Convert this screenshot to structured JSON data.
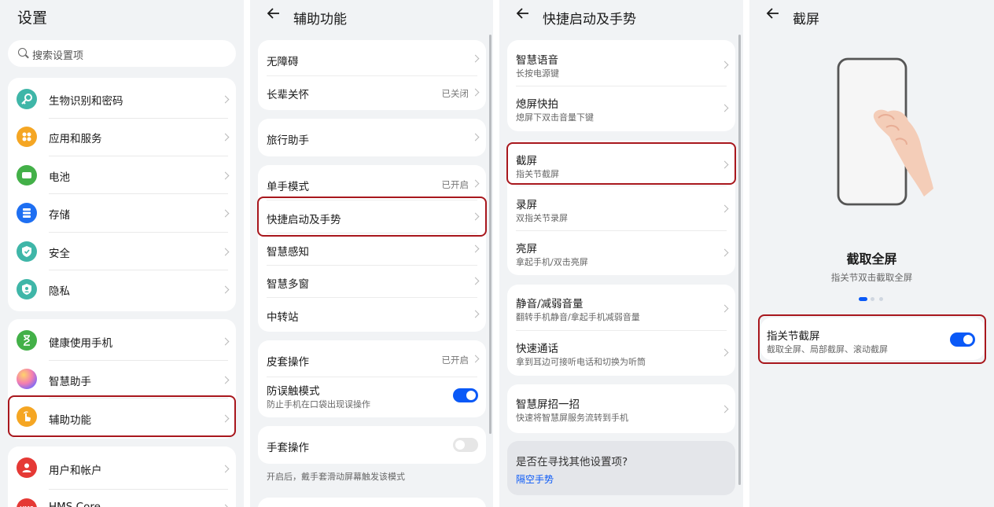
{
  "p1": {
    "title": "设置",
    "search_placeholder": "搜索设置项",
    "group1": [
      {
        "label": "生物识别和密码",
        "icon": "key-icon",
        "color": "#3fb6a8"
      },
      {
        "label": "应用和服务",
        "icon": "apps-icon",
        "color": "#f5a623"
      },
      {
        "label": "电池",
        "icon": "battery-icon",
        "color": "#43b048"
      },
      {
        "label": "存储",
        "icon": "storage-icon",
        "color": "#1e6ff2"
      },
      {
        "label": "安全",
        "icon": "shield-icon",
        "color": "#3fb6a8"
      },
      {
        "label": "隐私",
        "icon": "privacy-icon",
        "color": "#3fb6a8"
      }
    ],
    "group2": [
      {
        "label": "健康使用手机",
        "icon": "hourglass-icon",
        "color": "#43b048"
      },
      {
        "label": "智慧助手",
        "icon": "assistant-icon",
        "color": "#b36cf0"
      },
      {
        "label": "辅助功能",
        "icon": "hand-icon",
        "color": "#f5a623"
      }
    ],
    "group3": [
      {
        "label": "用户和帐户",
        "icon": "user-icon",
        "color": "#e53935"
      },
      {
        "label": "HMS Core",
        "icon": "hms-icon",
        "color": "#e53935",
        "glyph": "HMS"
      }
    ]
  },
  "p2": {
    "title": "辅助功能",
    "group1": [
      {
        "label": "无障碍",
        "value": ""
      },
      {
        "label": "长辈关怀",
        "value": "已关闭"
      }
    ],
    "group2": [
      {
        "label": "旅行助手",
        "value": ""
      }
    ],
    "group3": [
      {
        "label": "单手模式",
        "value": "已开启"
      },
      {
        "label": "快捷启动及手势",
        "value": ""
      },
      {
        "label": "智慧感知",
        "value": ""
      },
      {
        "label": "智慧多窗",
        "value": ""
      },
      {
        "label": "中转站",
        "value": ""
      }
    ],
    "group4": {
      "cover_label": "皮套操作",
      "cover_value": "已开启",
      "anti_label": "防误触模式",
      "anti_sub": "防止手机在口袋出现误操作",
      "anti_on": true
    },
    "group5": {
      "glove_label": "手套操作",
      "glove_on": false,
      "glove_note": "开启后，戴手套滑动屏幕触发该模式"
    }
  },
  "p3": {
    "title": "快捷启动及手势",
    "group1": [
      {
        "label": "智慧语音",
        "sub": "长按电源键"
      },
      {
        "label": "熄屏快拍",
        "sub": "熄屏下双击音量下键"
      }
    ],
    "group2": [
      {
        "label": "截屏",
        "sub": "指关节截屏"
      },
      {
        "label": "录屏",
        "sub": "双指关节录屏"
      },
      {
        "label": "亮屏",
        "sub": "拿起手机/双击亮屏"
      }
    ],
    "group3": [
      {
        "label": "静音/减弱音量",
        "sub": "翻转手机静音/拿起手机减弱音量"
      },
      {
        "label": "快速通话",
        "sub": "拿到耳边可接听电话和切换为听筒"
      }
    ],
    "group4": [
      {
        "label": "智慧屏招一招",
        "sub": "快速将智慧屏服务流转到手机"
      }
    ],
    "find": {
      "question": "是否在寻找其他设置项?",
      "link": "隔空手势"
    }
  },
  "p4": {
    "title": "截屏",
    "heading": "截取全屏",
    "caption": "指关节双击截取全屏",
    "page_index": 0,
    "page_count": 3,
    "toggle_label": "指关节截屏",
    "toggle_sub": "截取全屏、局部截屏、滚动截屏",
    "toggle_on": true
  }
}
